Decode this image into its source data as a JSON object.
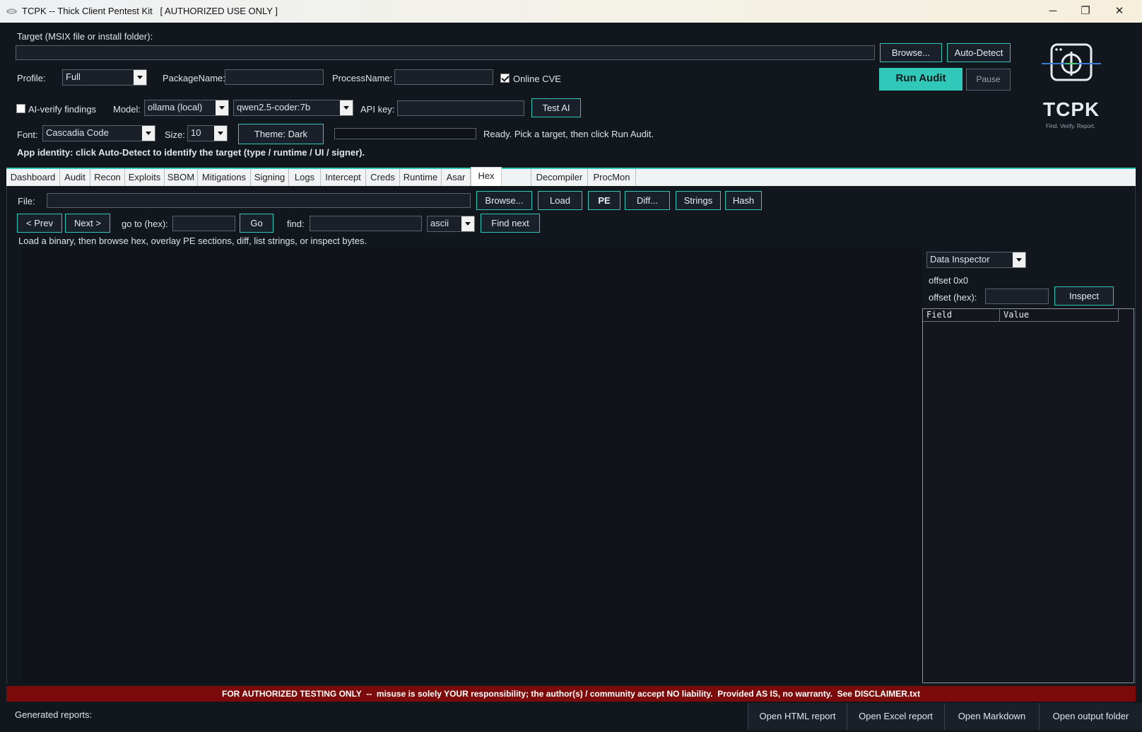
{
  "window": {
    "title": "TCPK -- Thick Client Pentest Kit   [ AUTHORIZED USE ONLY ]",
    "minimize": "─",
    "restore": "❐",
    "close": "✕"
  },
  "target": {
    "label": "Target (MSIX file or install folder):",
    "value": "",
    "browse_label": "Browse...",
    "autodetect_label": "Auto-Detect"
  },
  "profile": {
    "label": "Profile:",
    "value": "Full",
    "package_label": "PackageName:",
    "package_value": "",
    "process_label": "ProcessName:",
    "process_value": "",
    "online_cve_label": "Online CVE",
    "online_cve_checked": true
  },
  "actions": {
    "run_audit": "Run Audit",
    "pause": "Pause"
  },
  "ai": {
    "verify_label": "AI-verify findings",
    "verify_checked": false,
    "model_label": "Model:",
    "provider": "ollama (local)",
    "model": "qwen2.5-coder:7b",
    "api_key_label": "API key:",
    "api_key_value": "",
    "test_label": "Test AI"
  },
  "appearance": {
    "font_label": "Font:",
    "font_value": "Cascadia Code",
    "size_label": "Size:",
    "size_value": "10",
    "theme_label": "Theme: Dark",
    "status": "Ready. Pick a target, then click Run Audit."
  },
  "identity": "App identity: click Auto-Detect to identify the target (type / runtime / UI / signer).",
  "logo": {
    "name": "TCPK",
    "tagline": "Find. Verify. Report."
  },
  "tabs": [
    {
      "label": "Dashboard"
    },
    {
      "label": "Audit"
    },
    {
      "label": "Recon"
    },
    {
      "label": "Exploits"
    },
    {
      "label": "SBOM"
    },
    {
      "label": "Mitigations"
    },
    {
      "label": "Signing"
    },
    {
      "label": "Logs"
    },
    {
      "label": "Intercept"
    },
    {
      "label": "Creds"
    },
    {
      "label": "Runtime"
    },
    {
      "label": "Asar"
    },
    {
      "label": "Hex",
      "active": true
    },
    {
      "label": "Decompiler"
    },
    {
      "label": "ProcMon"
    }
  ],
  "hex": {
    "file_label": "File:",
    "file_value": "",
    "browse": "Browse...",
    "load": "Load",
    "pe": "PE",
    "diff": "Diff...",
    "strings": "Strings",
    "hash": "Hash",
    "prev": "< Prev",
    "next": "Next >",
    "goto_label": "go to (hex):",
    "goto_value": "",
    "go": "Go",
    "find_label": "find:",
    "find_value": "",
    "encoding": "ascii",
    "find_next": "Find next",
    "hint": "Load a binary, then browse hex, overlay PE sections, diff, list strings, or inspect bytes."
  },
  "inspector": {
    "mode": "Data Inspector",
    "offset_text": "offset 0x0",
    "offset_label": "offset (hex):",
    "offset_value": "",
    "inspect": "Inspect",
    "columns": [
      "Field",
      "Value"
    ]
  },
  "disclaimer": "FOR AUTHORIZED TESTING ONLY  --  misuse is solely YOUR responsibility; the author(s) / community accept NO liability.  Provided AS IS, no warranty.  See DISCLAIMER.txt",
  "footer": {
    "label": "Generated reports:",
    "buttons": [
      "Open HTML report",
      "Open Excel report",
      "Open Markdown",
      "Open output folder"
    ]
  },
  "colors": {
    "accent": "#2fc8b9",
    "background": "#12161d",
    "disclaimer_bg": "#7d0a0a"
  }
}
